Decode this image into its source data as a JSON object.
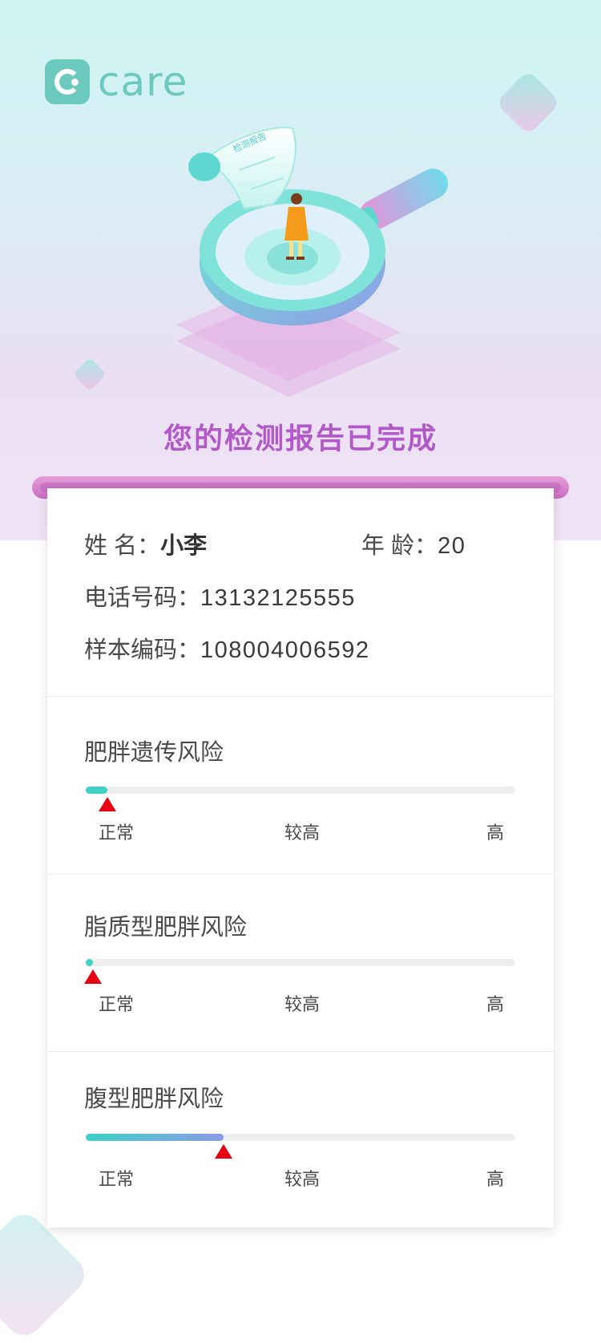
{
  "app": {
    "logo_text": "care"
  },
  "header": {
    "title": "您的检测报告已完成",
    "illustration_caption": "检测报告"
  },
  "profile": {
    "name_label": "姓 名：",
    "name_value": "小李",
    "age_label": "年 龄：",
    "age_value": "20",
    "phone_label": "电话号码：",
    "phone_value": "13132125555",
    "sample_label": "样本编码：",
    "sample_value": "108004006592"
  },
  "risks": [
    {
      "title": "肥胖遗传风险",
      "level_fraction": 0.05,
      "levels": [
        "正常",
        "较高",
        "高"
      ]
    },
    {
      "title": "脂质型肥胖风险",
      "level_fraction": 0.01,
      "levels": [
        "正常",
        "较高",
        "高"
      ]
    },
    {
      "title": "腹型肥胖风险",
      "level_fraction": 0.32,
      "levels": [
        "正常",
        "较高",
        "高"
      ]
    }
  ],
  "colors": {
    "accent": "#6cc9bd",
    "title": "#b259c9",
    "bar_start": "#3fd2c7",
    "bar_end": "#8a9ae6",
    "marker": "#e60012"
  },
  "icons": {
    "logo": "care-logo-icon",
    "marker": "triangle-up-icon"
  }
}
